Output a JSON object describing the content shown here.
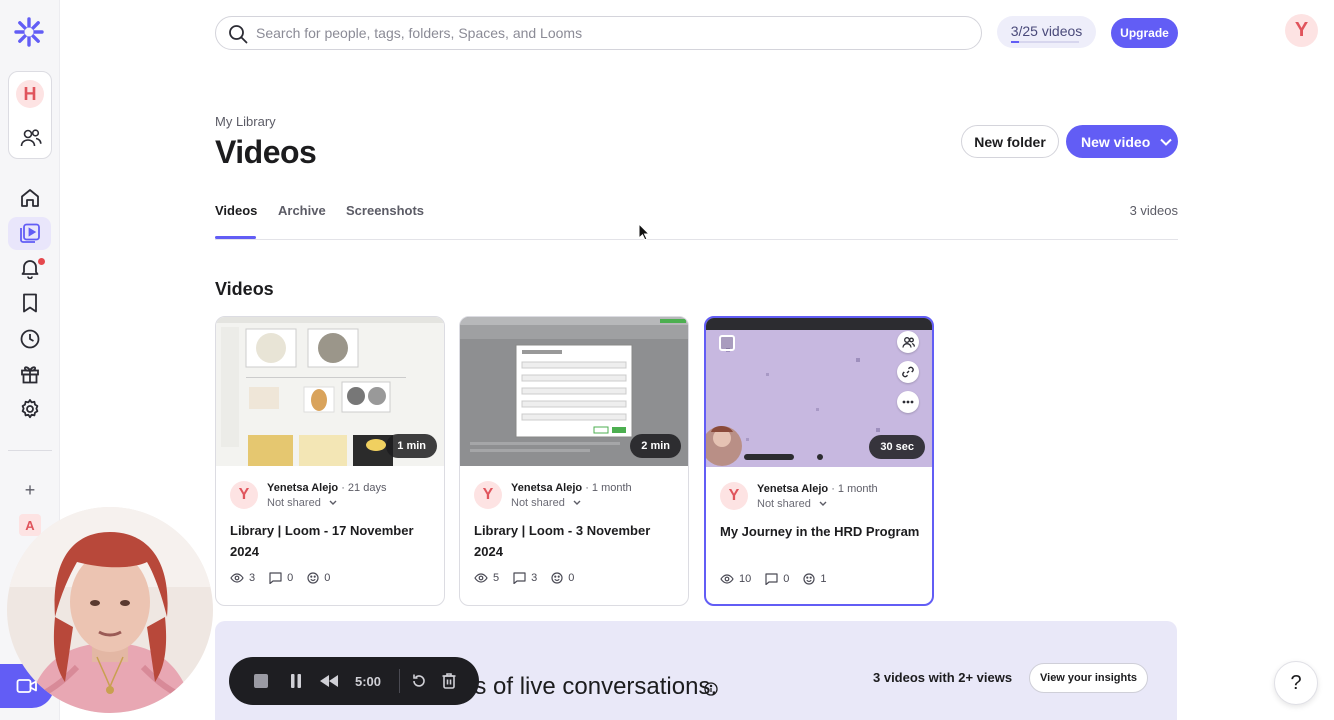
{
  "app": {
    "accent_color": "#625df5",
    "workspace_initial": "H",
    "secondary_workspace_initial": "A",
    "user_initial": "Y"
  },
  "search": {
    "placeholder": "Search for people, tags, folders, Spaces, and Looms"
  },
  "usage": {
    "label": "3/25 videos",
    "used": 3,
    "limit": 25
  },
  "header": {
    "upgrade_label": "Upgrade",
    "breadcrumb": "My Library",
    "title": "Videos",
    "new_folder_label": "New folder",
    "new_video_label": "New video"
  },
  "tabs": {
    "items": [
      {
        "label": "Videos",
        "active": true
      },
      {
        "label": "Archive",
        "active": false
      },
      {
        "label": "Screenshots",
        "active": false
      }
    ],
    "count_label": "3 videos"
  },
  "section": {
    "title": "Videos"
  },
  "videos": [
    {
      "duration": "1 min",
      "author_initial": "Y",
      "author": "Yenetsa Alejo",
      "age": "21 days",
      "sharing": "Not shared",
      "title": "Library | Loom - 17 November 2024",
      "views": "3",
      "comments": "0",
      "reactions": "0"
    },
    {
      "duration": "2 min",
      "author_initial": "Y",
      "author": "Yenetsa Alejo",
      "age": "1 month",
      "sharing": "Not shared",
      "title": "Library | Loom - 3 November 2024",
      "views": "5",
      "comments": "3",
      "reactions": "0"
    },
    {
      "duration": "30 sec",
      "author_initial": "Y",
      "author": "Yenetsa Alejo",
      "age": "1 month",
      "sharing": "Not shared",
      "title": "My Journey in the HRD Program",
      "views": "10",
      "comments": "0",
      "reactions": "1"
    }
  ],
  "insights": {
    "text": "es of live conversations.",
    "views_label": "3 videos with 2+ views",
    "button_label": "View your insights"
  },
  "recording": {
    "time": "5:00"
  },
  "help": {
    "label": "?"
  }
}
